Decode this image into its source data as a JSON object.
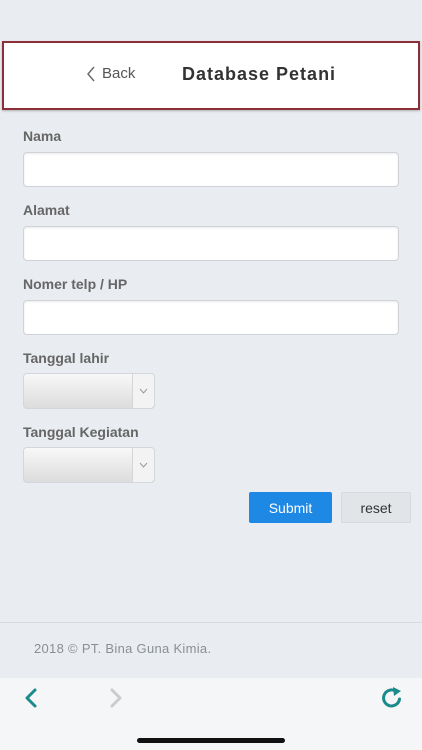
{
  "header": {
    "back_label": "Back",
    "title": "Database Petani",
    "frame_color": "#8c2f36"
  },
  "form": {
    "nama_label": "Nama",
    "nama_value": "",
    "alamat_label": "Alamat",
    "alamat_value": "",
    "telp_label": "Nomer telp / HP",
    "telp_value": "",
    "tanggal_lahir_label": "Tanggal lahir",
    "tanggal_lahir_value": "",
    "tanggal_kegiatan_label": "Tanggal Kegiatan",
    "tanggal_kegiatan_value": "",
    "submit_label": "Submit",
    "reset_label": "reset"
  },
  "footer": {
    "text": "2018 © PT. Bina Guna Kimia."
  },
  "toolbar": {
    "back_icon": "chevron-left-icon",
    "forward_icon": "chevron-right-icon",
    "refresh_icon": "refresh-icon",
    "accent": "#1a8a8a"
  },
  "colors": {
    "submit_button": "#1e88e5",
    "background": "#e9ecf0"
  }
}
